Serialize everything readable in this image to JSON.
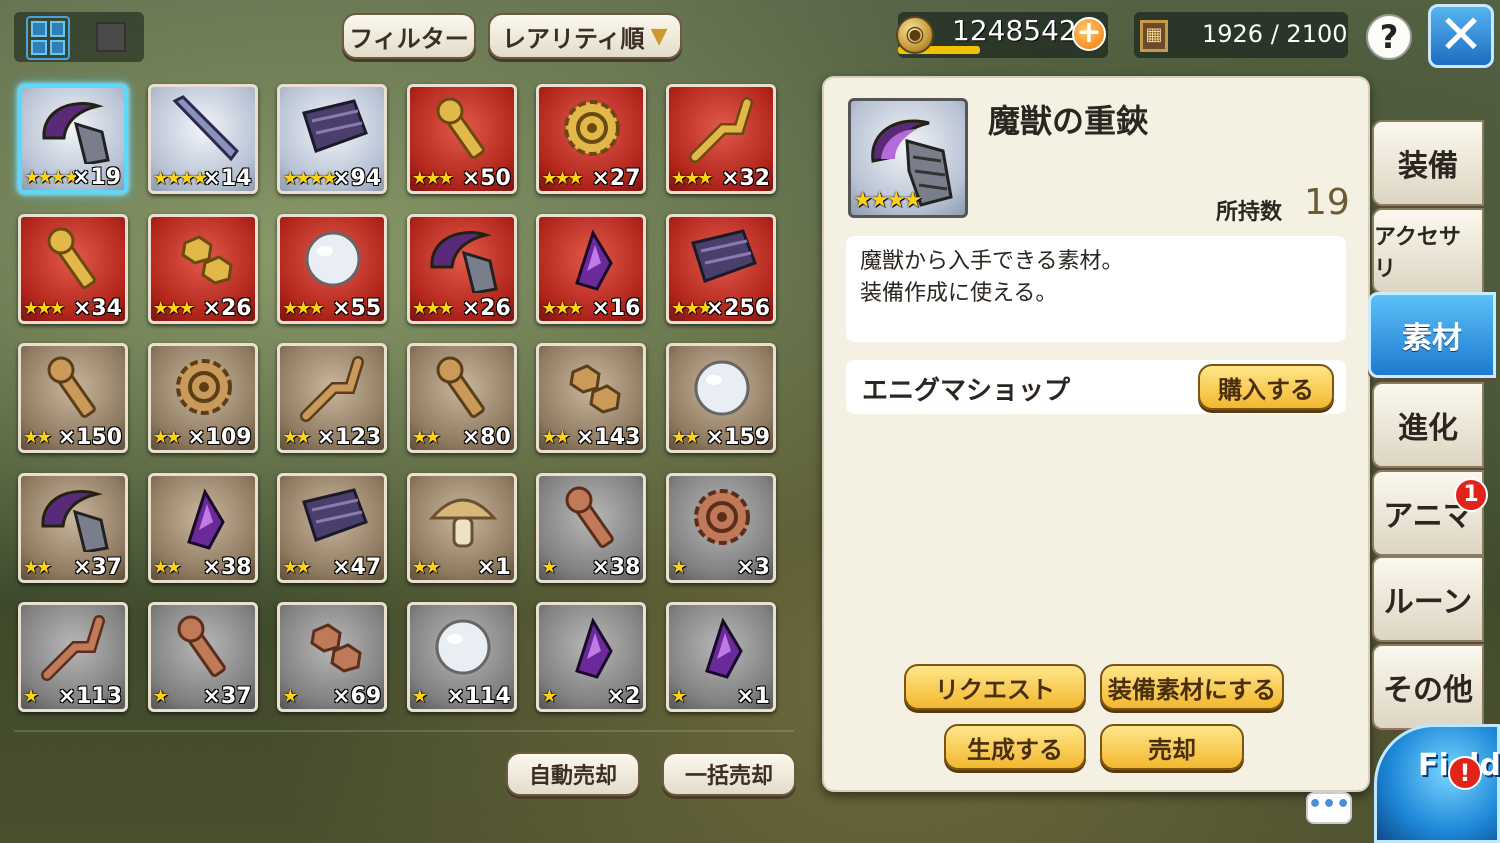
{
  "toolbar": {
    "filter_label": "フィルター",
    "sort_label": "レアリティ順",
    "coins": "1248542",
    "capacity": "1926 / 2100",
    "help": "?"
  },
  "items": [
    {
      "stars": "★★★★",
      "qty": "×19",
      "rarity": "r4",
      "icon": "claw-icon",
      "selected": true
    },
    {
      "stars": "★★★★",
      "qty": "×14",
      "rarity": "r4",
      "icon": "blade-icon"
    },
    {
      "stars": "★★★★",
      "qty": "×94",
      "rarity": "r4",
      "icon": "dark-anvil-icon"
    },
    {
      "stars": "★★★",
      "qty": "×50",
      "rarity": "r3",
      "icon": "gold-screw-icon"
    },
    {
      "stars": "★★★",
      "qty": "×27",
      "rarity": "r3",
      "icon": "gold-gear-icon"
    },
    {
      "stars": "★★★",
      "qty": "×32",
      "rarity": "r3",
      "icon": "gold-pipe-icon"
    },
    {
      "stars": "★★★",
      "qty": "×34",
      "rarity": "r3",
      "icon": "gold-bolt-icon"
    },
    {
      "stars": "★★★",
      "qty": "×26",
      "rarity": "r3",
      "icon": "gold-nut-icon"
    },
    {
      "stars": "★★★",
      "qty": "×55",
      "rarity": "r3",
      "icon": "orb-icon"
    },
    {
      "stars": "★★★",
      "qty": "×26",
      "rarity": "r3",
      "icon": "claw-icon"
    },
    {
      "stars": "★★★",
      "qty": "×16",
      "rarity": "r3",
      "icon": "crystal-icon"
    },
    {
      "stars": "★★★",
      "qty": "×256",
      "rarity": "r3",
      "icon": "dark-ore-icon"
    },
    {
      "stars": "★★",
      "qty": "×150",
      "rarity": "r2",
      "icon": "bronze-bolt-icon"
    },
    {
      "stars": "★★",
      "qty": "×109",
      "rarity": "r2",
      "icon": "bronze-gear-icon"
    },
    {
      "stars": "★★",
      "qty": "×123",
      "rarity": "r2",
      "icon": "bronze-pipe-icon"
    },
    {
      "stars": "★★",
      "qty": "×80",
      "rarity": "r2",
      "icon": "bronze-screw-icon"
    },
    {
      "stars": "★★",
      "qty": "×143",
      "rarity": "r2",
      "icon": "bronze-nut-icon"
    },
    {
      "stars": "★★",
      "qty": "×159",
      "rarity": "r2",
      "icon": "orb-icon"
    },
    {
      "stars": "★★",
      "qty": "×37",
      "rarity": "r2",
      "icon": "claw-icon"
    },
    {
      "stars": "★★",
      "qty": "×38",
      "rarity": "r2",
      "icon": "crystal-icon"
    },
    {
      "stars": "★★",
      "qty": "×47",
      "rarity": "r2",
      "icon": "dark-ore-icon"
    },
    {
      "stars": "★★",
      "qty": "×1",
      "rarity": "r2",
      "icon": "mushroom-icon"
    },
    {
      "stars": "★",
      "qty": "×38",
      "rarity": "r1",
      "icon": "copper-bolt-icon"
    },
    {
      "stars": "★",
      "qty": "×3",
      "rarity": "r1",
      "icon": "copper-gear-icon"
    },
    {
      "stars": "★",
      "qty": "×113",
      "rarity": "r1",
      "icon": "copper-pipe-icon"
    },
    {
      "stars": "★",
      "qty": "×37",
      "rarity": "r1",
      "icon": "copper-screw-icon"
    },
    {
      "stars": "★",
      "qty": "×69",
      "rarity": "r1",
      "icon": "copper-nut-icon"
    },
    {
      "stars": "★",
      "qty": "×114",
      "rarity": "r1",
      "icon": "cracked-orb-icon"
    },
    {
      "stars": "★",
      "qty": "×2",
      "rarity": "r1",
      "icon": "purple-shard-icon"
    },
    {
      "stars": "★",
      "qty": "×1",
      "rarity": "r1",
      "icon": "purple-fang-icon"
    }
  ],
  "bottom_buttons": {
    "auto_sell": "自動売却",
    "bulk_sell": "一括売却"
  },
  "detail": {
    "title": "魔獣の重鋏",
    "stars": "★★★★",
    "owned_label": "所持数",
    "owned_value": "19",
    "description_line1": "魔獣から入手できる素材。",
    "description_line2": "装備作成に使える。",
    "shop_label": "エニグマショップ",
    "buy_label": "購入する",
    "request_label": "リクエスト",
    "equip_material_label": "装備素材にする",
    "generate_label": "生成する",
    "sell_label": "売却"
  },
  "tabs": [
    {
      "label": "装備"
    },
    {
      "label": "アクセサリ"
    },
    {
      "label": "素材",
      "active": true
    },
    {
      "label": "進化"
    },
    {
      "label": "アニマ",
      "badge": "1"
    },
    {
      "label": "ルーン"
    },
    {
      "label": "その他"
    }
  ],
  "field": {
    "label": "Field",
    "alert": "!"
  },
  "chat": "•••",
  "colors": {
    "accent": "#2e8fe0",
    "gold": "#f2b82e",
    "star": "#ffd21a"
  }
}
